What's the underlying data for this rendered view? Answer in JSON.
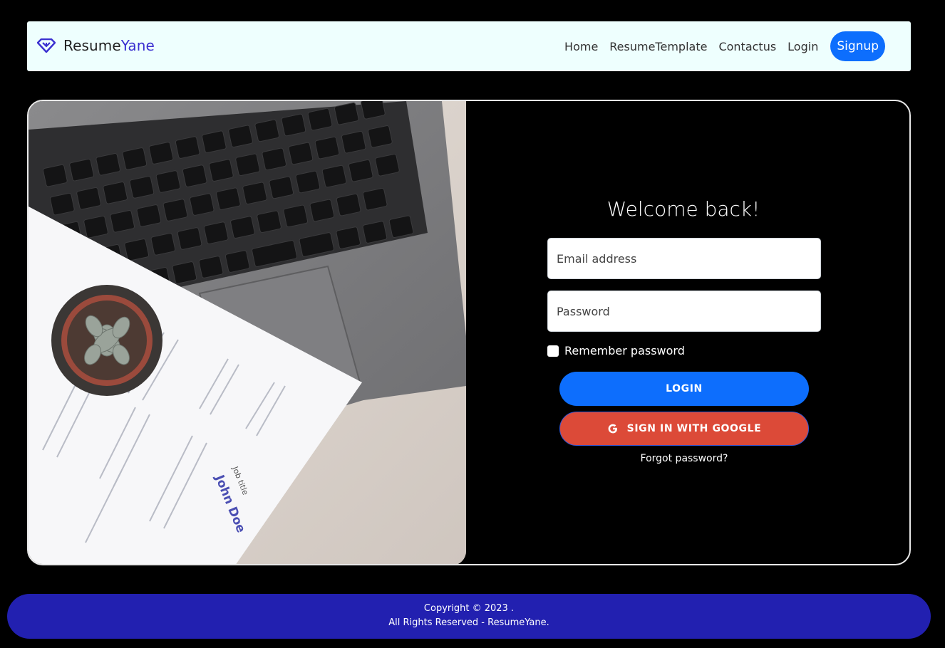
{
  "navbar": {
    "brand_prefix": "Resume",
    "brand_suffix": "Yane",
    "links": [
      "Home",
      "ResumeTemplate",
      "Contactus",
      "Login"
    ],
    "signup_label": "Signup",
    "accent_color": "#3a2fd0",
    "button_color": "#0d6efd"
  },
  "form": {
    "title": "Welcome back!",
    "email_placeholder": "Email address",
    "password_placeholder": "Password",
    "remember_label": "Remember password",
    "login_label": "LOGIN",
    "google_label": "SIGN IN WITH GOOGLE",
    "forgot_label": "Forgot password?",
    "google_color": "#dc4a38"
  },
  "illustration": {
    "icon": "laptop-resume-photo",
    "resume_name": "John Doe",
    "resume_subtitle": "Job title"
  },
  "footer": {
    "line1": "Copyright © 2023 .",
    "line2": "All Rights Reserved   - ResumeYane.",
    "color": "#2220b0"
  }
}
